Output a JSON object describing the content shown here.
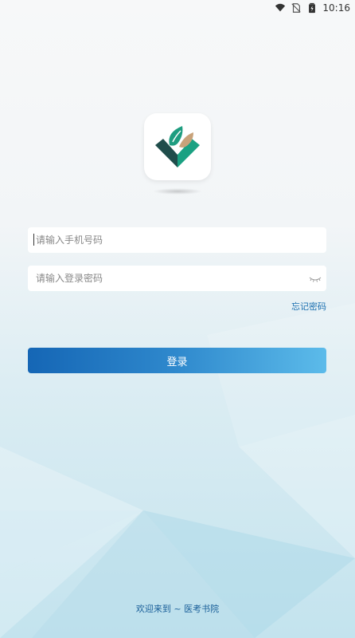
{
  "status_bar": {
    "time": "10:16",
    "icons": [
      "wifi-icon",
      "no-sim-icon",
      "battery-icon"
    ]
  },
  "logo": {
    "icon": "app-logo-icon",
    "colors": {
      "dark_green": "#1f4d4b",
      "teal": "#1a9b7e",
      "tan": "#c8a27a"
    }
  },
  "login": {
    "phone_placeholder": "请输入手机号码",
    "phone_value": "",
    "password_placeholder": "请输入登录密码",
    "password_value": "",
    "forgot_password": "忘记密码",
    "submit_label": "登录"
  },
  "footer": {
    "welcome_text": "欢迎来到 ~ 医考书院"
  },
  "colors": {
    "accent": "#1a6fb0",
    "button_start": "#1566b5",
    "button_end": "#5cbbea"
  }
}
